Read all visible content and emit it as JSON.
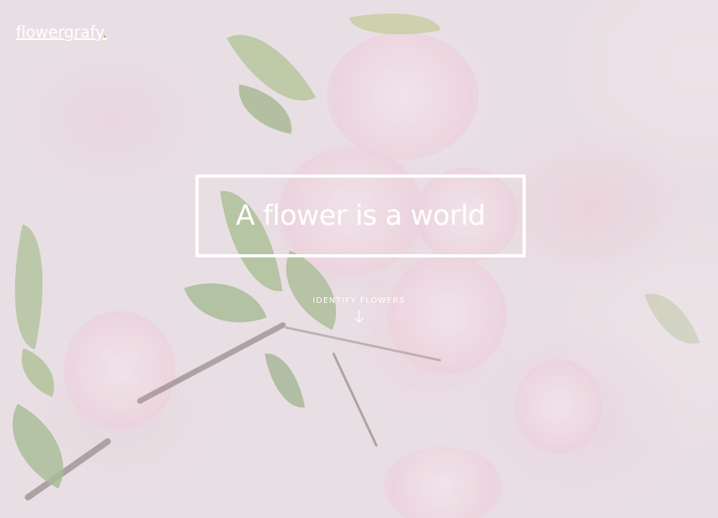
{
  "header": {
    "brand_name": "flowergrafy",
    "brand_dot": ".",
    "brand_dot_color": "#e7a33e"
  },
  "hero": {
    "background_image": "pink-cherry-blossom-photo",
    "headline": "A flower is a world",
    "cta_label": "IDENTIFY FLOWERS",
    "cta_icon": "arrow-down-icon"
  },
  "colors": {
    "text": "#ffffff",
    "frame": "#ffffff"
  }
}
